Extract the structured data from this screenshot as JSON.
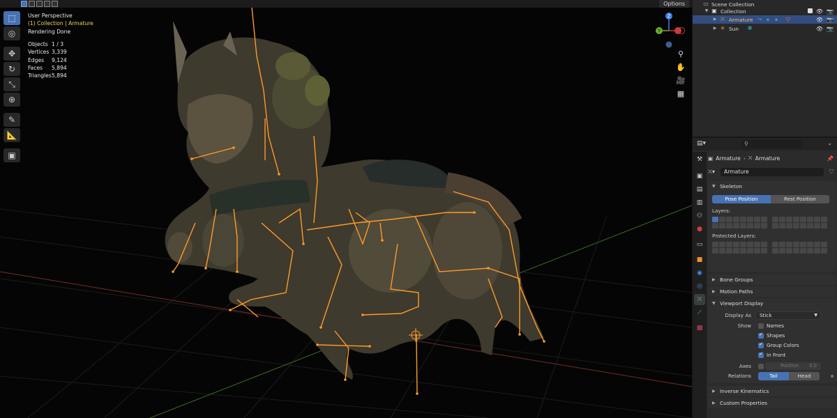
{
  "viewport": {
    "options_label": "Options",
    "perspective": "User Perspective",
    "collection_context": "(1) Collection | Armature",
    "render_status": "Rendering Done",
    "stats": [
      {
        "key": "Objects",
        "value": "1 / 3"
      },
      {
        "key": "Vertices",
        "value": "3,339"
      },
      {
        "key": "Edges",
        "value": "9,124"
      },
      {
        "key": "Faces",
        "value": "5,894"
      },
      {
        "key": "Triangles",
        "value": "5,894"
      }
    ],
    "tools": [
      "select-box-icon",
      "cursor-icon",
      "move-icon",
      "rotate-icon",
      "scale-icon",
      "transform-icon",
      "annotate-icon",
      "measure-icon",
      "add-cube-icon"
    ],
    "gizmo_axes": {
      "z": "Z",
      "y": "Y"
    },
    "colors": {
      "x_axis": "#c83c3c",
      "y_axis": "#6eae2c",
      "z_axis": "#3f7ee8",
      "bones": "#ff9a2a"
    }
  },
  "outliner": {
    "rows": [
      {
        "label": "Scene Collection"
      },
      {
        "label": "Collection"
      },
      {
        "label": "Armature"
      },
      {
        "label": "Sun"
      }
    ]
  },
  "properties": {
    "search_placeholder": "",
    "breadcrumb": {
      "object": "Armature",
      "data": "Armature"
    },
    "data_name": "Armature",
    "skeleton": {
      "title": "Skeleton",
      "pose_position": "Pose Position",
      "rest_position": "Rest Position",
      "layers_label": "Layers:",
      "protected_layers_label": "Protected Layers:"
    },
    "panels": {
      "bone_groups": "Bone Groups",
      "motion_paths": "Motion Paths",
      "viewport_display": "Viewport Display",
      "inverse_kinematics": "Inverse Kinematics",
      "custom_properties": "Custom Properties"
    },
    "viewport_display": {
      "display_as_label": "Display As",
      "display_as_value": "Stick",
      "show_label": "Show",
      "names": "Names",
      "shapes": "Shapes",
      "group_colors": "Group Colors",
      "in_front": "In Front",
      "axes_label": "Axes",
      "position_label": "Position",
      "position_value": "0.0",
      "relations_label": "Relations",
      "tail": "Tail",
      "head": "Head"
    }
  }
}
